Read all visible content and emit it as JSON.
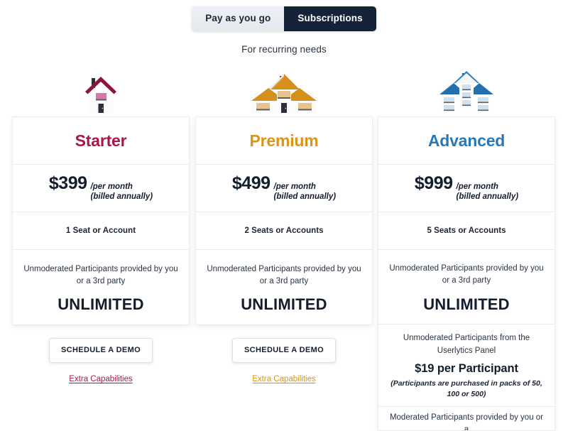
{
  "toggle": {
    "inactive_label": "Pay as you go",
    "active_label": "Subscriptions"
  },
  "subheading": "For recurring needs",
  "colors": {
    "starter": "#a8174a",
    "premium": "#d99518",
    "advanced": "#2878b8",
    "toggle_active_bg": "#152338",
    "toggle_inactive_bg": "#e8edf2",
    "card_border": "#e9edf1",
    "text": "#1b2430"
  },
  "plans": [
    {
      "id": "starter",
      "icon": "small-house-icon",
      "name": "Starter",
      "price_amount": "$399",
      "price_per": "/per month",
      "price_billed": "(billed annually)",
      "seats": "1 Seat or Account",
      "unmoderated_desc": "Unmoderated Participants provided by you or a 3rd party",
      "unmoderated_value": "UNLIMITED",
      "cta_label": "SCHEDULE A DEMO",
      "extra_link": "Extra Capabilities"
    },
    {
      "id": "premium",
      "icon": "medium-house-icon",
      "name": "Premium",
      "price_amount": "$499",
      "price_per": "/per month",
      "price_billed": "(billed annually)",
      "seats": "2 Seats or Accounts",
      "unmoderated_desc": "Unmoderated Participants provided by you or a 3rd party",
      "unmoderated_value": "UNLIMITED",
      "cta_label": "SCHEDULE A DEMO",
      "extra_link": "Extra Capabilities"
    },
    {
      "id": "advanced",
      "icon": "apartment-building-icon",
      "name": "Advanced",
      "price_amount": "$999",
      "price_per": "/per month",
      "price_billed": "(billed annually)",
      "seats": "5 Seats or Accounts",
      "unmoderated_desc": "Unmoderated Participants provided by you or a 3rd party",
      "unmoderated_value": "UNLIMITED",
      "panel_desc": "Unmoderated Participants from the Userlytics Panel",
      "panel_price": "$19 per Participant",
      "panel_note": "(Participants are purchased in packs of 50, 100 or 500)",
      "cut_desc": "Moderated Participants provided by you or a"
    }
  ]
}
